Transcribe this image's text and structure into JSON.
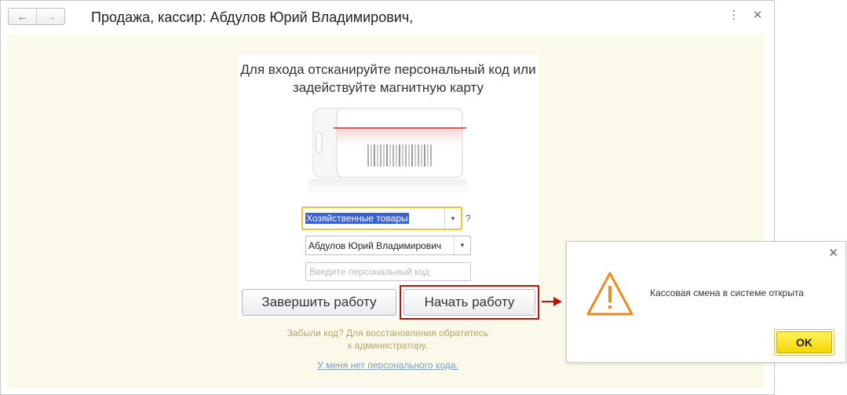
{
  "window": {
    "title": "Продажа, кассир: Абдулов Юрий Владимирович,",
    "back_icon": "←",
    "forward_icon": "→",
    "menu_icon": "⋮",
    "close_icon": "✕"
  },
  "login": {
    "prompt": "Для входа отсканируйте персональный код или задействуйте магнитную карту",
    "department_value": "Хозяйственные товары",
    "help_mark": "?",
    "cashier_value": "Абдулов Юрий Владимирович",
    "code_placeholder": "Введите персональный код",
    "finish_button": "Завершить работу",
    "start_button": "Начать работу",
    "forgot_text": "Забыли код? Для восстановления обратитесь к администратору.",
    "no_code_link": "У меня нет персонального кода."
  },
  "dialog": {
    "message": "Кассовая смена в системе открыта",
    "ok_button": "OK",
    "close_icon": "✕"
  },
  "colors": {
    "content_bg": "#fbf9ea",
    "focus_border": "#f2c23a",
    "highlight_red": "#c40f0f",
    "warning_orange": "#ee8a1c",
    "ok_yellow": "#f4d500"
  }
}
